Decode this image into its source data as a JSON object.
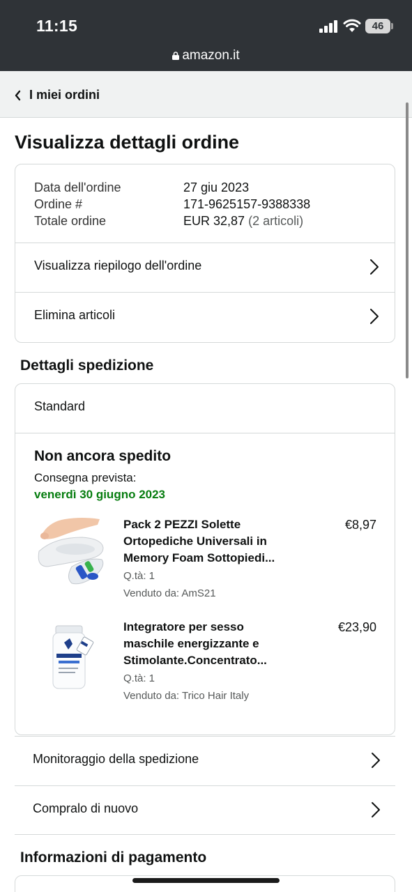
{
  "status_bar": {
    "time": "11:15",
    "battery": "46",
    "icons": [
      "signal-icon",
      "wifi-icon",
      "battery-icon"
    ]
  },
  "browser": {
    "url": "amazon.it",
    "icon": "lock-icon"
  },
  "nav": {
    "back_label": "I miei ordini",
    "icon": "chevron-left-icon"
  },
  "page": {
    "title": "Visualizza dettagli ordine"
  },
  "summary": {
    "rows": [
      {
        "label": "Data dell'ordine",
        "value": "27 giu 2023"
      },
      {
        "label": "Ordine #",
        "value": "171-9625157-9388338"
      },
      {
        "label": "Totale ordine",
        "value": "EUR 32,87",
        "extra": "(2 articoli)"
      }
    ],
    "links": [
      {
        "label": "Visualizza riepilogo dell'ordine"
      },
      {
        "label": "Elimina articoli"
      }
    ]
  },
  "shipping": {
    "section_title": "Dettagli spedizione",
    "type": "Standard",
    "status": "Non ancora spedito",
    "delivery_label": "Consegna prevista:",
    "delivery_date": "venerdì 30 giugno 2023",
    "items": [
      {
        "title": "Pack 2 PEZZI Solette Ortopediche Universali in Memory Foam Sottopiedi...",
        "price": "€8,97",
        "qty": "Q.tà: 1",
        "seller": "Venduto da: AmS21"
      },
      {
        "title": "Integratore per sesso maschile energizzante e Stimolante.Concentrato...",
        "price": "€23,90",
        "qty": "Q.tà: 1",
        "seller": "Venduto da: Trico Hair Italy"
      }
    ]
  },
  "actions": [
    {
      "label": "Monitoraggio della spedizione"
    },
    {
      "label": "Compralo di nuovo"
    }
  ],
  "payment": {
    "section_title": "Informazioni di pagamento"
  },
  "colors": {
    "status_bar": "#2f3337",
    "delivery_green": "#067d0f",
    "border": "#d5d9d9",
    "back_bar": "#f0f2f2"
  }
}
